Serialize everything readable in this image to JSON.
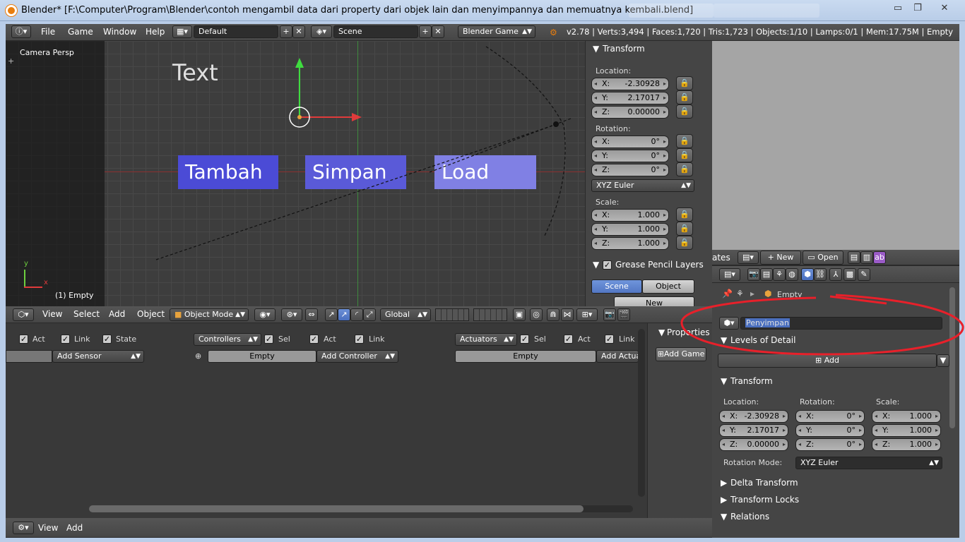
{
  "window": {
    "title": "Blender* [F:\\Computer\\Program\\Blender\\contoh mengambil data dari property  dari objek lain dan menyimpannya dan memuatnya kembali.blend]",
    "minimize": "▭",
    "maximize": "❐",
    "close": "✕"
  },
  "info_header": {
    "menus": [
      "File",
      "Game",
      "Window",
      "Help"
    ],
    "layout": "Default",
    "scene": "Scene",
    "engine": "Blender Game",
    "stats": "v2.78 | Verts:3,494 | Faces:1,720 | Tris:1,723 | Objects:1/10 | Lamps:0/1 | Mem:17.75M | Empty"
  },
  "viewport": {
    "view_label": "Camera Persp",
    "object_label": "(1) Empty",
    "text_object": "Text",
    "buttons": [
      "Tambah",
      "Simpan",
      "Load"
    ],
    "axis_y": "y",
    "axis_x": "x"
  },
  "transform_panel": {
    "title": "Transform",
    "location_label": "Location:",
    "location": [
      {
        "axis": "X:",
        "value": "-2.30928"
      },
      {
        "axis": "Y:",
        "value": "2.17017"
      },
      {
        "axis": "Z:",
        "value": "0.00000"
      }
    ],
    "rotation_label": "Rotation:",
    "rotation": [
      {
        "axis": "X:",
        "value": "0°"
      },
      {
        "axis": "Y:",
        "value": "0°"
      },
      {
        "axis": "Z:",
        "value": "0°"
      }
    ],
    "rotation_mode": "XYZ Euler",
    "scale_label": "Scale:",
    "scale": [
      {
        "axis": "X:",
        "value": "1.000"
      },
      {
        "axis": "Y:",
        "value": "1.000"
      },
      {
        "axis": "Z:",
        "value": "1.000"
      }
    ],
    "grease_title": "Grease Pencil Layers",
    "grease_tabs": [
      "Scene",
      "Object"
    ],
    "grease_new": "New"
  },
  "view3d_header": {
    "menus": [
      "View",
      "Select",
      "Add",
      "Object"
    ],
    "mode": "Object Mode",
    "orientation": "Global"
  },
  "logic": {
    "sensor_flags": [
      "Act",
      "Link",
      "State"
    ],
    "controllers_label": "Controllers",
    "controller_flags": [
      "Sel",
      "Act",
      "Link"
    ],
    "actuators_label": "Actuators",
    "actuator_flags": [
      "Sel",
      "Act",
      "Link"
    ],
    "add_sensor": "Add Sensor",
    "controller_obj": "Empty",
    "add_controller": "Add Controller",
    "actuator_obj": "Empty",
    "add_actuator": "Add Actua",
    "properties_label": "Properties",
    "add_game": "Add Game"
  },
  "bottom_header": {
    "menus": [
      "View",
      "Add"
    ]
  },
  "image_header": {
    "partial": "ates",
    "new": "New",
    "open": "Open"
  },
  "props": {
    "breadcrumb": "Empty",
    "object_name": "Penyimpan",
    "lod_title": "Levels of Detail",
    "add": "Add",
    "transform_title": "Transform",
    "location_label": "Location:",
    "rotation_label": "Rotation:",
    "scale_label": "Scale:",
    "location": [
      {
        "axis": "X:",
        "value": "-2.30928"
      },
      {
        "axis": "Y:",
        "value": "2.17017"
      },
      {
        "axis": "Z:",
        "value": "0.00000"
      }
    ],
    "rotation": [
      {
        "axis": "X:",
        "value": "0°"
      },
      {
        "axis": "Y:",
        "value": "0°"
      },
      {
        "axis": "Z:",
        "value": "0°"
      }
    ],
    "scale": [
      {
        "axis": "X:",
        "value": "1.000"
      },
      {
        "axis": "Y:",
        "value": "1.000"
      },
      {
        "axis": "Z:",
        "value": "1.000"
      }
    ],
    "rotation_mode_label": "Rotation Mode:",
    "rotation_mode": "XYZ Euler",
    "delta": "Delta Transform",
    "locks": "Transform Locks",
    "relations": "Relations"
  },
  "colors": {
    "annotation": "#e8202a",
    "game_button": "#4b4bd6",
    "accent": "#5377c4"
  }
}
